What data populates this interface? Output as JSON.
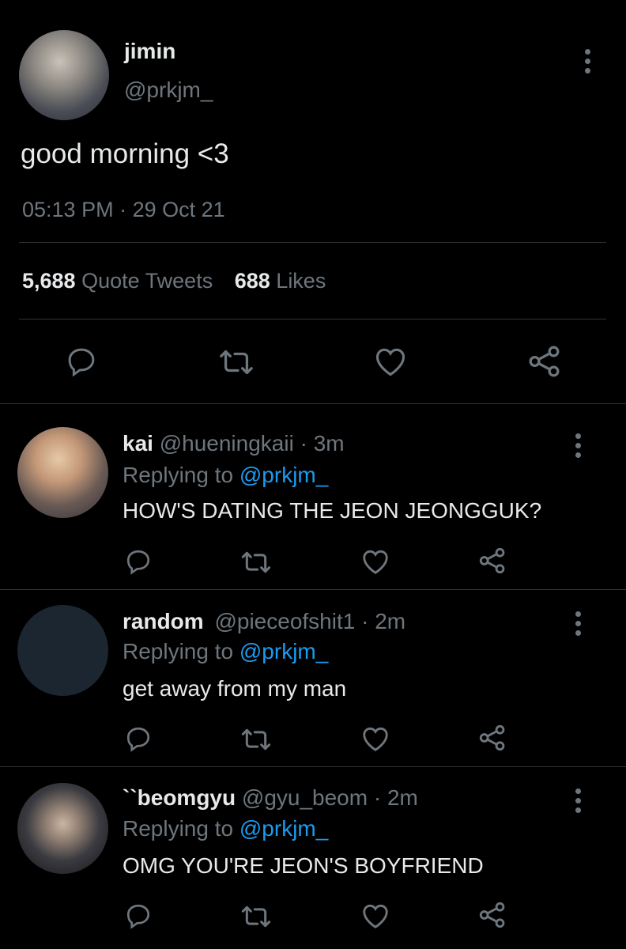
{
  "main_tweet": {
    "name": "jimin",
    "handle": "@prkjm_",
    "text": "good morning <3",
    "time": "05:13 PM",
    "date_sep": "·",
    "date": "29 Oct 21",
    "quote_count": "5,688",
    "quote_label": "Quote Tweets",
    "like_count": "688",
    "like_label": "Likes"
  },
  "replies": [
    {
      "name": "kai",
      "handle": "@hueningkaii",
      "time": "· 3m",
      "replying_prefix": "Replying to",
      "replying_to": "@prkjm_",
      "text": "HOW'S DATING THE JEON JEONGGUK?"
    },
    {
      "name": "random",
      "handle": "@pieceofshit1",
      "time": "· 2m",
      "replying_prefix": "Replying to",
      "replying_to": "@prkjm_",
      "text": "get away from my man"
    },
    {
      "name": "``beomgyu",
      "handle": "@gyu_beom",
      "time": "· 2m",
      "replying_prefix": "Replying to",
      "replying_to": "@prkjm_",
      "text": "OMG YOU'RE JEON'S BOYFRIEND"
    }
  ],
  "icons": {
    "reply": "reply-icon",
    "retweet": "retweet-icon",
    "like": "heart-icon",
    "share": "share-icon",
    "more": "more-vertical-icon"
  },
  "colors": {
    "background": "#000000",
    "link": "#1d9bf0",
    "secondary": "#6e767d",
    "divider": "#2f3336"
  }
}
